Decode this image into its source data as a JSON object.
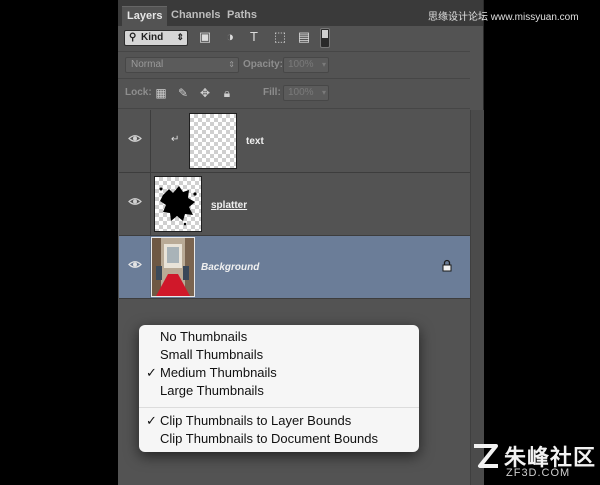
{
  "tabs": [
    {
      "label": "Layers",
      "active": true
    },
    {
      "label": "Channels",
      "active": false
    },
    {
      "label": "Paths",
      "active": false
    }
  ],
  "filter": {
    "kind_label": "Kind",
    "icons": [
      "image-filter-icon",
      "adjustment-filter-icon",
      "type-filter-icon",
      "shape-filter-icon",
      "smart-object-filter-icon",
      "filter-toggle"
    ]
  },
  "blend": {
    "mode": "Normal",
    "opacity_label": "Opacity:",
    "opacity_value": "100%",
    "lock_label": "Lock:",
    "fill_label": "Fill:",
    "fill_value": "100%"
  },
  "layers": [
    {
      "name": "text",
      "selected": false,
      "clipped": true,
      "visible": true
    },
    {
      "name": "splatter",
      "selected": false,
      "clipped": false,
      "visible": true
    },
    {
      "name": "Background",
      "selected": true,
      "clipped": false,
      "visible": true,
      "locked": true
    }
  ],
  "menu": {
    "items": [
      {
        "label": "No Thumbnails",
        "checked": false
      },
      {
        "label": "Small Thumbnails",
        "checked": false
      },
      {
        "label": "Medium Thumbnails",
        "checked": true,
        "check": "✓"
      },
      {
        "label": "Large Thumbnails",
        "checked": false
      },
      {
        "label": "Clip Thumbnails to Layer Bounds",
        "checked": true,
        "check": "✓"
      },
      {
        "label": "Clip Thumbnails to Document Bounds",
        "checked": false
      }
    ]
  },
  "watermark": {
    "top": "思缘设计论坛 www.missyuan.com",
    "title": "朱峰社区",
    "url": "ZF3D.COM"
  },
  "colors": {
    "panel": "#535353",
    "selected_row": "#6b7d98",
    "menu_bg": "#f6f6f6"
  }
}
